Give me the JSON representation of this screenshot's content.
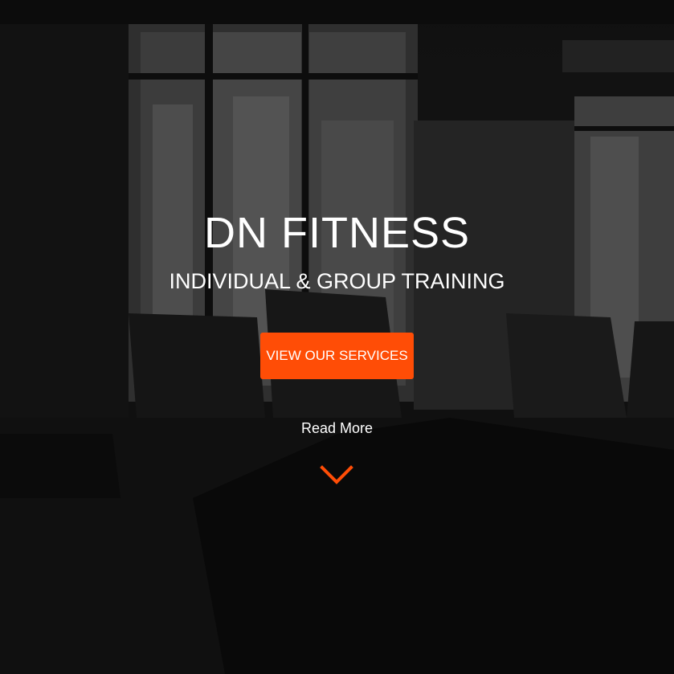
{
  "hero": {
    "title": "DN FITNESS",
    "subtitle": "INDIVIDUAL & GROUP TRAINING",
    "cta_label": "VIEW OUR SERVICES",
    "read_more_label": "Read More",
    "scroll_icon": "chevron-down-icon",
    "background_image": "dark gym interior with treadmills and windows",
    "accent_color": "#ff4d06"
  }
}
